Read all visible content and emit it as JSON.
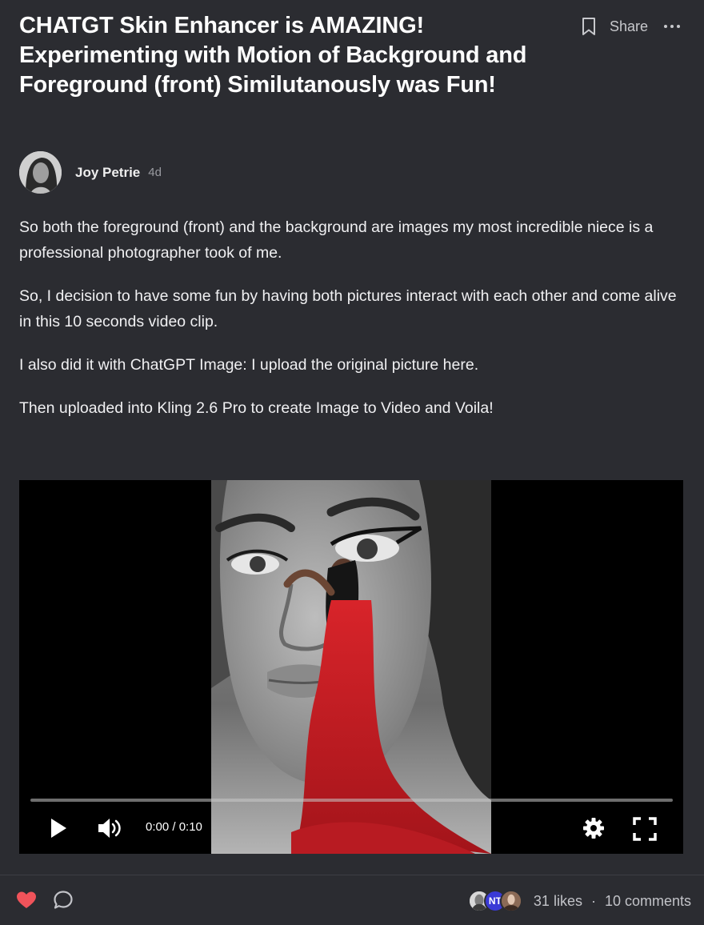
{
  "post": {
    "title": "CHATGT Skin Enhancer is AMAZING! Experimenting with Motion of Background and Foreground (front) Similutanously was Fun!",
    "author": {
      "name": "Joy Petrie",
      "age": "4d"
    },
    "paragraphs": [
      "So both the foreground (front) and the background are images my most incredible niece  is a professional photographer took of me.",
      "So, I decision to have some fun by having both pictures interact with each other and come alive in this 10 seconds video clip.",
      "I also did it with ChatGPT Image: I upload the original picture here.",
      "Then  uploaded into Kling 2.6 Pro to create Image to Video and Voila!"
    ]
  },
  "actions": {
    "share_label": "Share",
    "bookmark_icon": "bookmark-icon",
    "more_icon": "more-options-icon"
  },
  "video": {
    "time": "0:00 / 0:10",
    "progress": 0,
    "icons": [
      "play-icon",
      "volume-icon",
      "settings-icon",
      "fullscreen-icon"
    ]
  },
  "footer": {
    "liker_initials": "NT",
    "likes": "31 likes",
    "separator": "·",
    "comments": "10 comments",
    "colors": {
      "heart": "#f0535a",
      "initials_bg": "#3a3ad6"
    }
  }
}
